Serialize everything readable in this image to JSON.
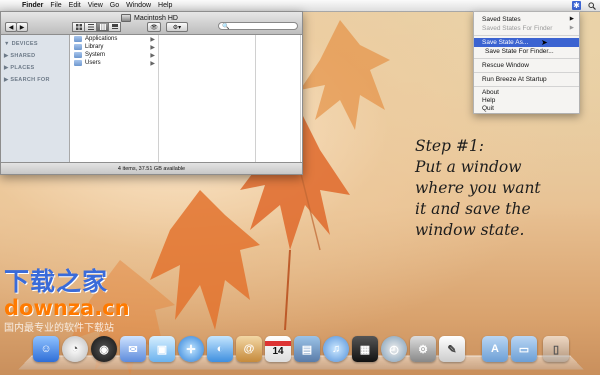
{
  "menubar": {
    "apple": "",
    "items": [
      "Finder",
      "File",
      "Edit",
      "View",
      "Go",
      "Window",
      "Help"
    ]
  },
  "finder": {
    "title": "Macintosh HD",
    "nav_back": "◀",
    "nav_forward": "▶",
    "eye": "👁",
    "gear": "⚙▾",
    "search_icon": "🔍",
    "sidebar": [
      "▼ DEVICES",
      "▶ SHARED",
      "▶ PLACES",
      "▶ SEARCH FOR"
    ],
    "items": [
      "Applications",
      "Library",
      "System",
      "Users"
    ],
    "status": "4 items, 37.51 GB available"
  },
  "menu": {
    "saved_states": "Saved States",
    "saved_states_for_finder": "Saved States For Finder",
    "save_state_as": "Save State As...",
    "save_state_for_finder": "Save State For Finder...",
    "rescue_window": "Rescue Window",
    "run_at_startup": "Run Breeze At Startup",
    "about": "About",
    "help": "Help",
    "quit": "Quit"
  },
  "note": [
    "Step #1:",
    "Put a window",
    "where you want",
    "it and save the",
    "window state."
  ],
  "watermark": {
    "title": "下载之家",
    "domain": "downza.cn",
    "tagline": "国内最专业的软件下载站"
  },
  "dock": {
    "calendar_day": "14"
  },
  "colors": {
    "highlight": "#3b63d1",
    "watermark_blue": "#3a6bd9",
    "watermark_orange": "#ff7a00"
  }
}
